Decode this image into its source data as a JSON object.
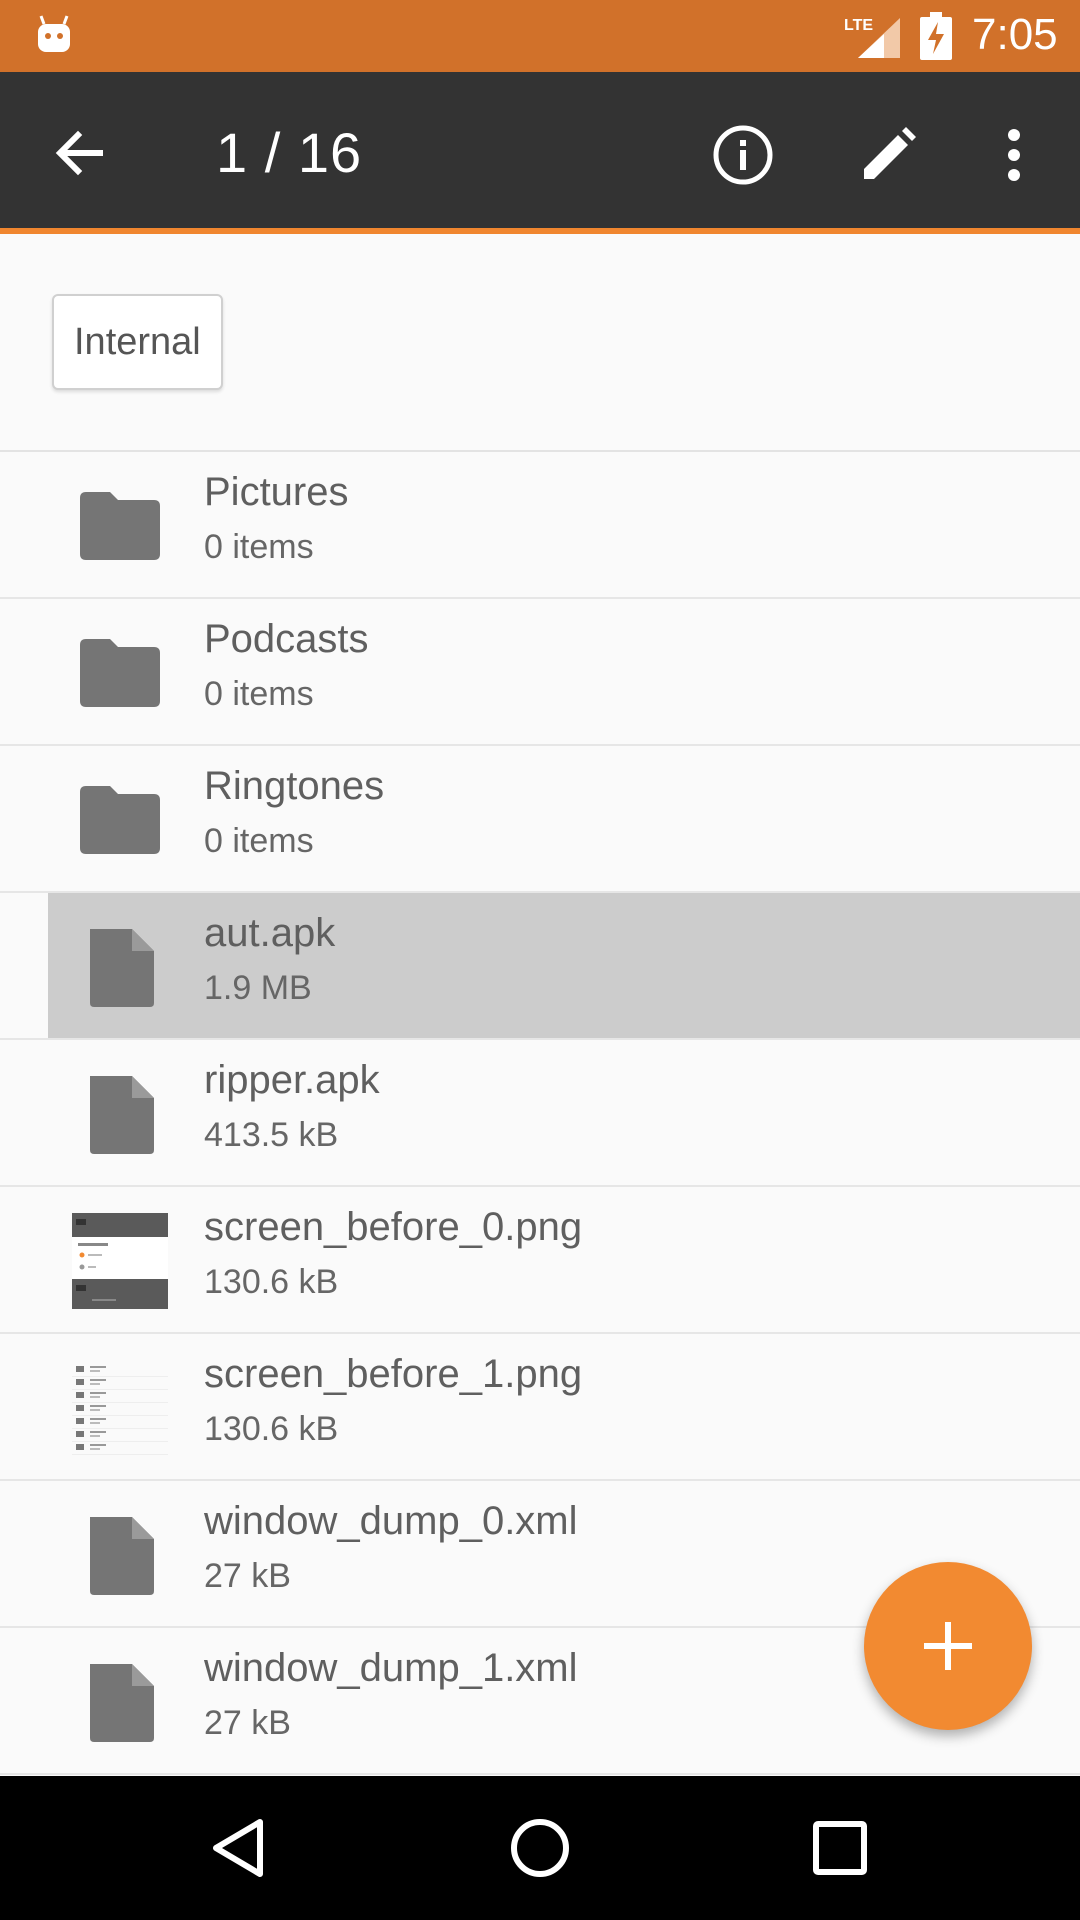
{
  "status_bar": {
    "time": "7:05",
    "network": "LTE",
    "colors": {
      "background": "#d1712a"
    }
  },
  "toolbar": {
    "title": "1 / 16",
    "icons": [
      "back-arrow-icon",
      "info-icon",
      "edit-pencil-icon",
      "more-vert-icon"
    ],
    "colors": {
      "background": "#333333",
      "accent": "#f0862f"
    }
  },
  "breadcrumb": {
    "label": "Internal"
  },
  "files": [
    {
      "name": "Pictures",
      "meta": "0 items",
      "type": "folder",
      "selected": false
    },
    {
      "name": "Podcasts",
      "meta": "0 items",
      "type": "folder",
      "selected": false
    },
    {
      "name": "Ringtones",
      "meta": "0 items",
      "type": "folder",
      "selected": false
    },
    {
      "name": "aut.apk",
      "meta": "1.9 MB",
      "type": "file",
      "selected": true
    },
    {
      "name": "ripper.apk",
      "meta": "413.5 kB",
      "type": "file",
      "selected": false
    },
    {
      "name": "screen_before_0.png",
      "meta": "130.6 kB",
      "type": "image-dark",
      "selected": false
    },
    {
      "name": "screen_before_1.png",
      "meta": "130.6 kB",
      "type": "image-light",
      "selected": false
    },
    {
      "name": "window_dump_0.xml",
      "meta": "27 kB",
      "type": "file",
      "selected": false
    },
    {
      "name": "window_dump_1.xml",
      "meta": "27 kB",
      "type": "file",
      "selected": false
    }
  ],
  "fab": {
    "icon": "plus-icon",
    "color": "#f28a31"
  },
  "nav": {
    "icons": [
      "back-triangle-icon",
      "home-circle-icon",
      "recents-square-icon"
    ]
  }
}
